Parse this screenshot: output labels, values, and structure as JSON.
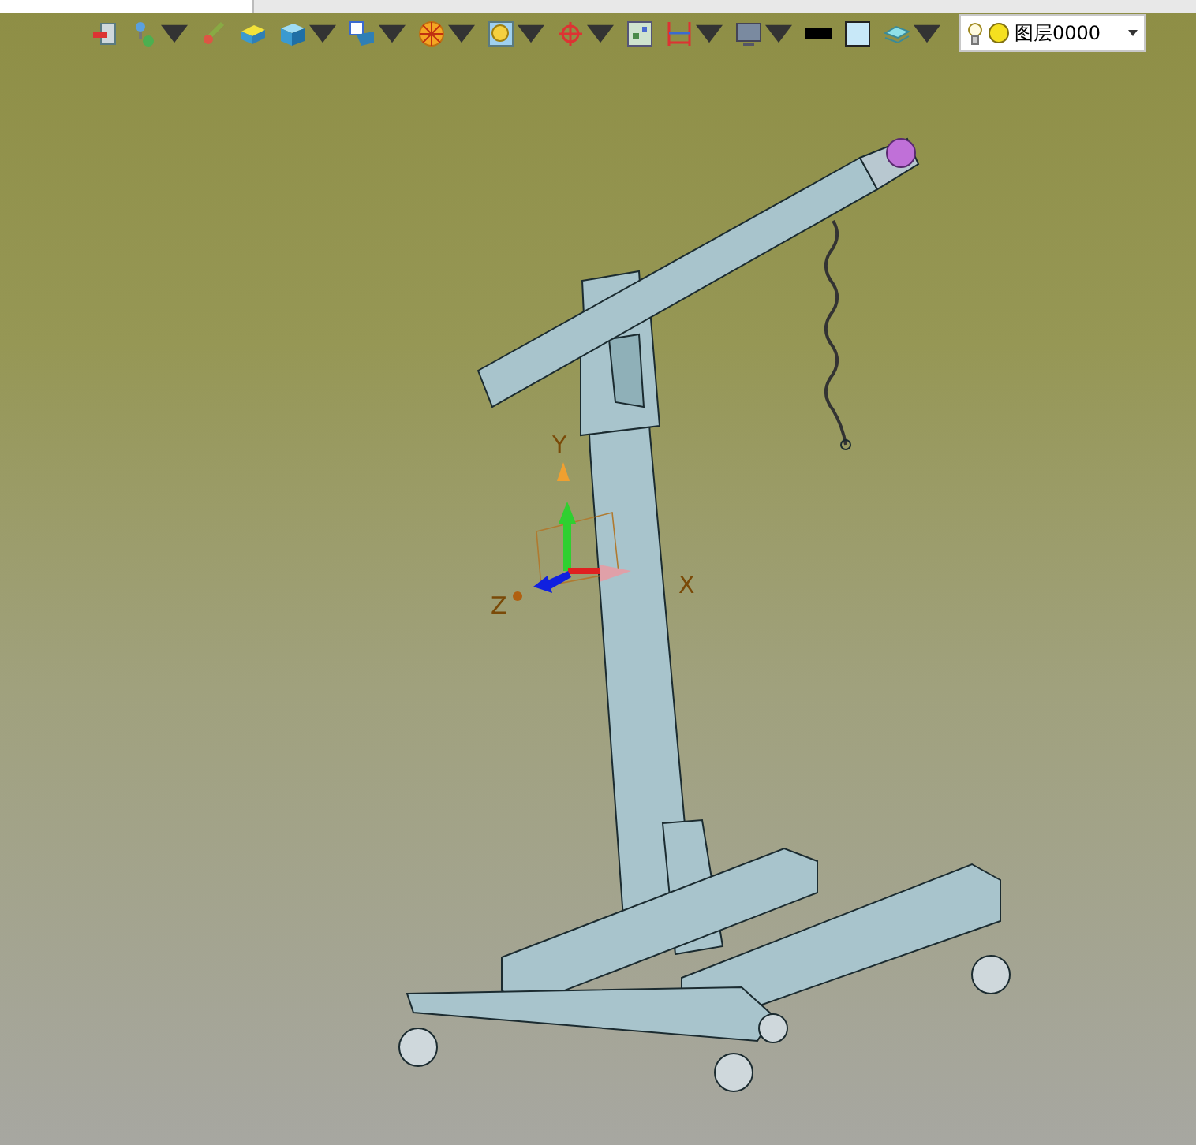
{
  "toolbar": {
    "buttons": [
      {
        "kind": "exit",
        "dropdown": false
      },
      {
        "kind": "tree",
        "dropdown": true
      },
      {
        "kind": "brush",
        "dropdown": false
      },
      {
        "kind": "block",
        "dropdown": false
      },
      {
        "kind": "cube",
        "dropdown": true
      },
      {
        "kind": "cubeframe",
        "dropdown": true
      },
      {
        "kind": "wheel",
        "dropdown": true
      },
      {
        "kind": "zoom",
        "dropdown": true
      },
      {
        "kind": "crosshair",
        "dropdown": true
      },
      {
        "kind": "picture",
        "dropdown": false
      },
      {
        "kind": "dimension",
        "dropdown": true
      },
      {
        "kind": "monitor",
        "dropdown": true
      },
      {
        "kind": "line",
        "dropdown": false
      },
      {
        "kind": "square",
        "dropdown": false
      },
      {
        "kind": "layers",
        "dropdown": true
      }
    ],
    "layer_select": {
      "value": "图层0000"
    }
  },
  "viewport": {
    "axes": {
      "x_label": "X",
      "y_label": "Y",
      "z_label": "Z"
    }
  }
}
